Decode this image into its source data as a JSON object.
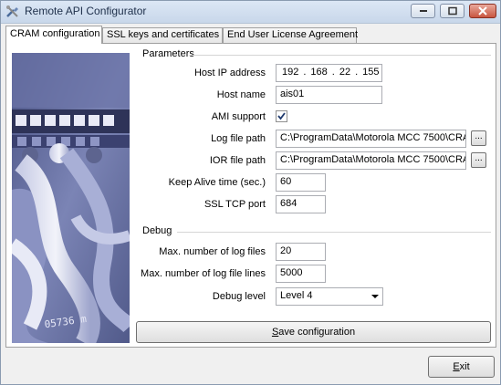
{
  "window": {
    "title": "Remote API Configurator",
    "icon": "wrench-screwdriver-icon"
  },
  "tabs": [
    {
      "label": "CRAM configuration",
      "active": true
    },
    {
      "label": "SSL keys and certificates",
      "active": false
    },
    {
      "label": "End User License Agreement",
      "active": false
    }
  ],
  "parameters": {
    "section_label": "Parameters",
    "host_ip": {
      "label": "Host IP address",
      "octets": [
        "192",
        "168",
        "22",
        "155"
      ]
    },
    "host_name": {
      "label": "Host name",
      "value": "ais01"
    },
    "ami_support": {
      "label": "AMI support",
      "checked": true
    },
    "log_file_path": {
      "label": "Log file path",
      "value": "C:\\ProgramData\\Motorola MCC 7500\\CRA",
      "browse_label": "..."
    },
    "ior_file_path": {
      "label": "IOR file path",
      "value": "C:\\ProgramData\\Motorola MCC 7500\\CRA",
      "browse_label": "..."
    },
    "keep_alive": {
      "label": "Keep Alive time (sec.)",
      "value": "60"
    },
    "ssl_tcp_port": {
      "label": "SSL TCP port",
      "value": "684"
    }
  },
  "debug": {
    "section_label": "Debug",
    "max_log_files": {
      "label": "Max. number of log files",
      "value": "20"
    },
    "max_log_lines": {
      "label": "Max. number of log file lines",
      "value": "5000"
    },
    "debug_level": {
      "label": "Debug level",
      "value": "Level 4"
    }
  },
  "buttons": {
    "save_prefix": "S",
    "save_rest": "ave configuration",
    "exit_prefix": "E",
    "exit_rest": "xit"
  },
  "photo": {
    "cable_label": "05736 m"
  }
}
